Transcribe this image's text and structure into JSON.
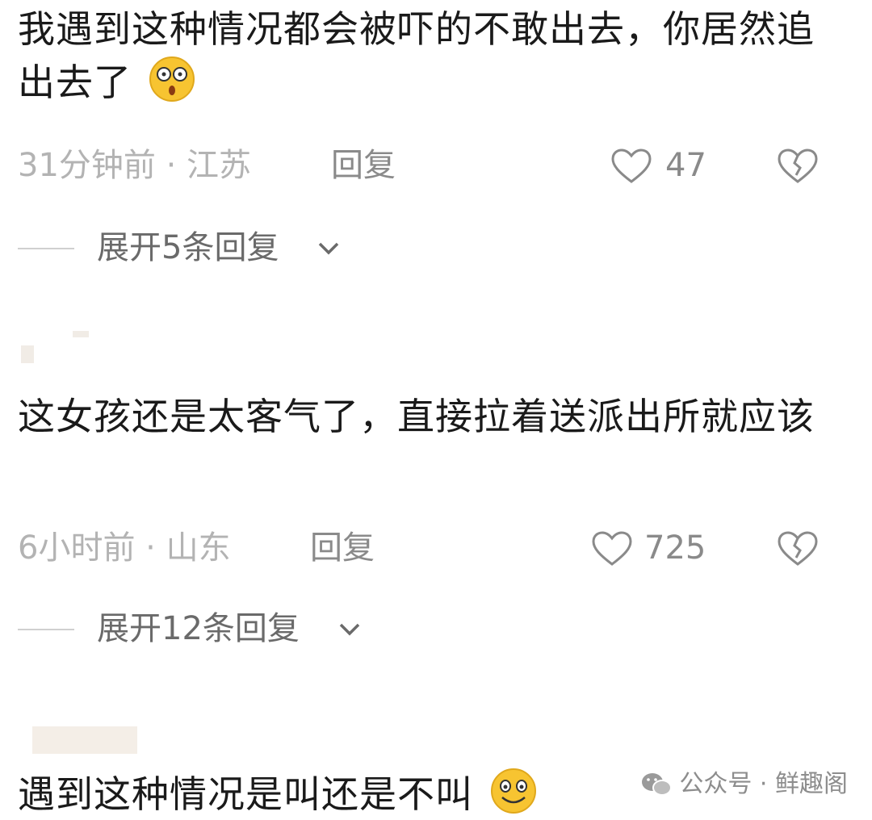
{
  "comments": [
    {
      "text": "我遇到这种情况都会被吓的不敢出去，你居然追出去了",
      "emoji": "shocked-face-emoji",
      "time_location": "31分钟前 · 江苏",
      "reply_label": "回复",
      "likes": "47",
      "expand_label": "展开5条回复"
    },
    {
      "text": "这女孩还是太客气了，直接拉着送派出所就应该",
      "time_location": "6小时前 · 山东",
      "reply_label": "回复",
      "likes": "725",
      "expand_label": "展开12条回复"
    },
    {
      "text": "遇到这种情况是叫还是不叫",
      "emoji": "smiling-face-emoji"
    }
  ],
  "watermark": {
    "label": "公众号 · 鲜趣阁",
    "icon": "wechat-icon"
  },
  "colors": {
    "text": "#1a1a1a",
    "meta": "#b3b3b3",
    "action": "#8a8a8a"
  }
}
